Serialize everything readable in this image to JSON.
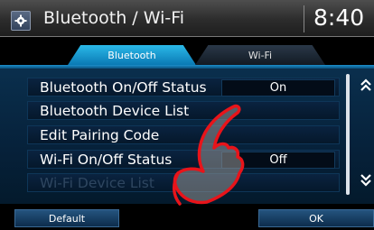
{
  "header": {
    "title": "Bluetooth / Wi-Fi",
    "clock": "8:40",
    "settings_icon": "gear-icon"
  },
  "tabs": [
    {
      "label": "Bluetooth",
      "active": true
    },
    {
      "label": "Wi-Fi",
      "active": false
    }
  ],
  "list": {
    "rows": [
      {
        "label": "Bluetooth On/Off Status",
        "value": "On"
      },
      {
        "label": "Bluetooth Device List",
        "value": ""
      },
      {
        "label": "Edit Pairing Code",
        "value": ""
      },
      {
        "label": "Wi-Fi On/Off Status",
        "value": "Off"
      },
      {
        "label": "Wi-Fi Device List",
        "value": "",
        "disabled": true
      }
    ],
    "scroll_up_icon": "double-chevron-up-icon",
    "scroll_down_icon": "double-chevron-down-icon"
  },
  "buttons": {
    "default_label": "Default",
    "ok_label": "OK"
  },
  "colors": {
    "active_tab": "#1a9ad6",
    "panel_bg": "#06213a",
    "finger_outline": "#e8141a"
  }
}
